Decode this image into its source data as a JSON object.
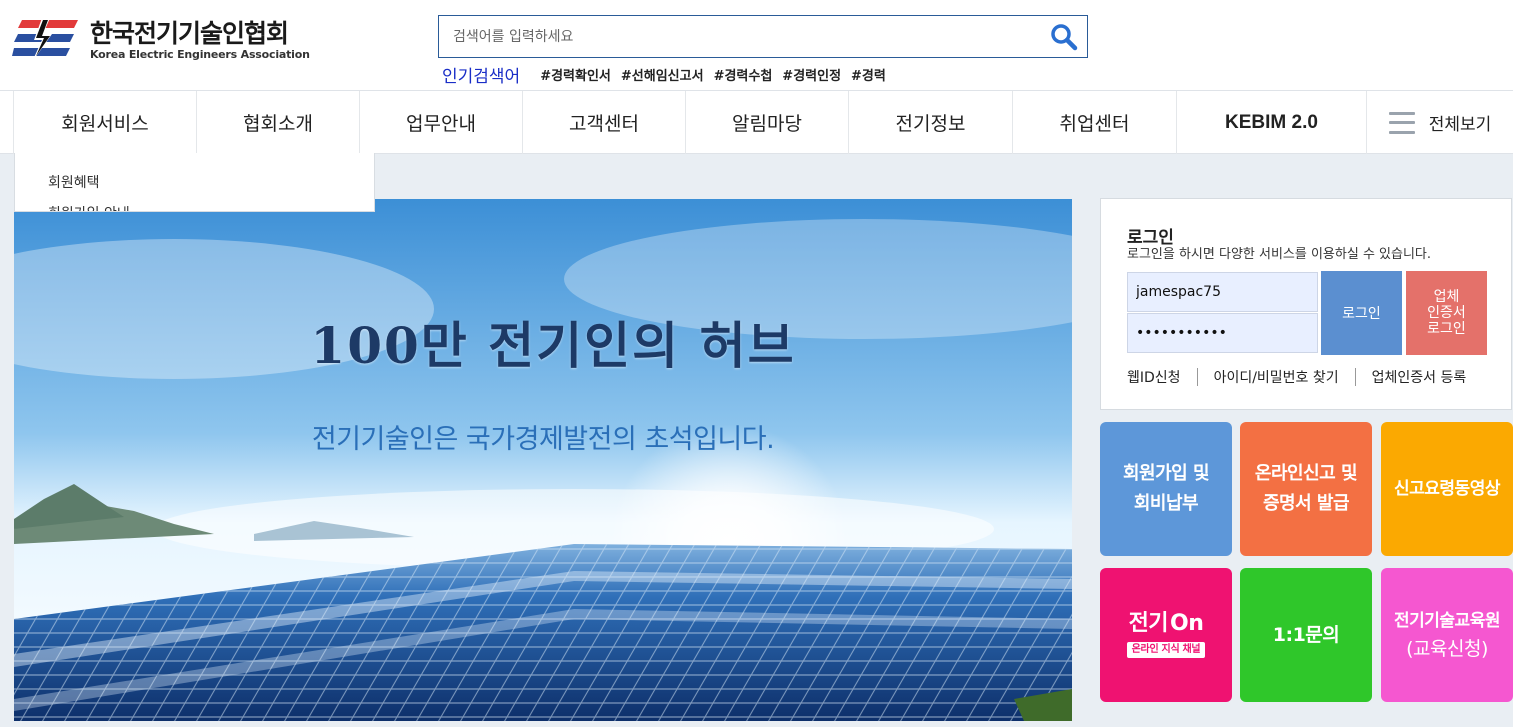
{
  "header": {
    "logo_ko": "한국전기기술인협회",
    "logo_en": "Korea Electric Engineers Association",
    "search_placeholder": "검색어를 입력하세요",
    "popular_label": "인기검색어",
    "popular_tags": [
      "#경력확인서",
      "#선해임신고서",
      "#경력수첩",
      "#경력인정",
      "#경력"
    ]
  },
  "nav": {
    "items": [
      "회원서비스",
      "협회소개",
      "업무안내",
      "고객센터",
      "알림마당",
      "전기정보",
      "취업센터",
      "KEBIM 2.0"
    ],
    "all_label": "전체보기"
  },
  "dropdown": {
    "items": [
      "회원혜택",
      "회원가입 안내"
    ]
  },
  "banner": {
    "title": "100만 전기인의 허브",
    "subtitle": "전기기술인은 국가경제발전의 초석입니다."
  },
  "login": {
    "title": "로그인",
    "description": "로그인을 하시면 다양한 서비스를 이용하실 수 있습니다.",
    "id_value": "jamespac75",
    "pw_value": "•••••••••••",
    "login_button": "로그인",
    "cert_button": [
      "업체",
      "인증서",
      "로그인"
    ],
    "links": [
      "웹ID신청",
      "아이디/비밀번호 찾기",
      "업체인증서 등록"
    ]
  },
  "tiles": {
    "t1": [
      "회원가입 및",
      "회비납부"
    ],
    "t2": [
      "온라인신고 및",
      "증명서 발급"
    ],
    "t3": "신고요령동영상",
    "t4_logo": "전기",
    "t4_logo_on": "On",
    "t4_sub": "온라인 지식 채널",
    "t5": "1:1문의",
    "t6": [
      "전기기술교육원",
      "(교육신청)"
    ]
  },
  "colors": {
    "accent_blue": "#2a5b98",
    "login_btn": "#5b8fd0",
    "cert_btn": "#e4716a",
    "tile_blue": "#5d97d9",
    "tile_orange": "#f37043",
    "tile_yellow": "#fba901",
    "tile_pink": "#ef1271",
    "tile_green": "#2fc72a",
    "tile_magenta": "#f557d0"
  },
  "icons": {
    "search": "search-icon",
    "menu": "hamburger-icon",
    "logo": "kea-logo-icon"
  }
}
